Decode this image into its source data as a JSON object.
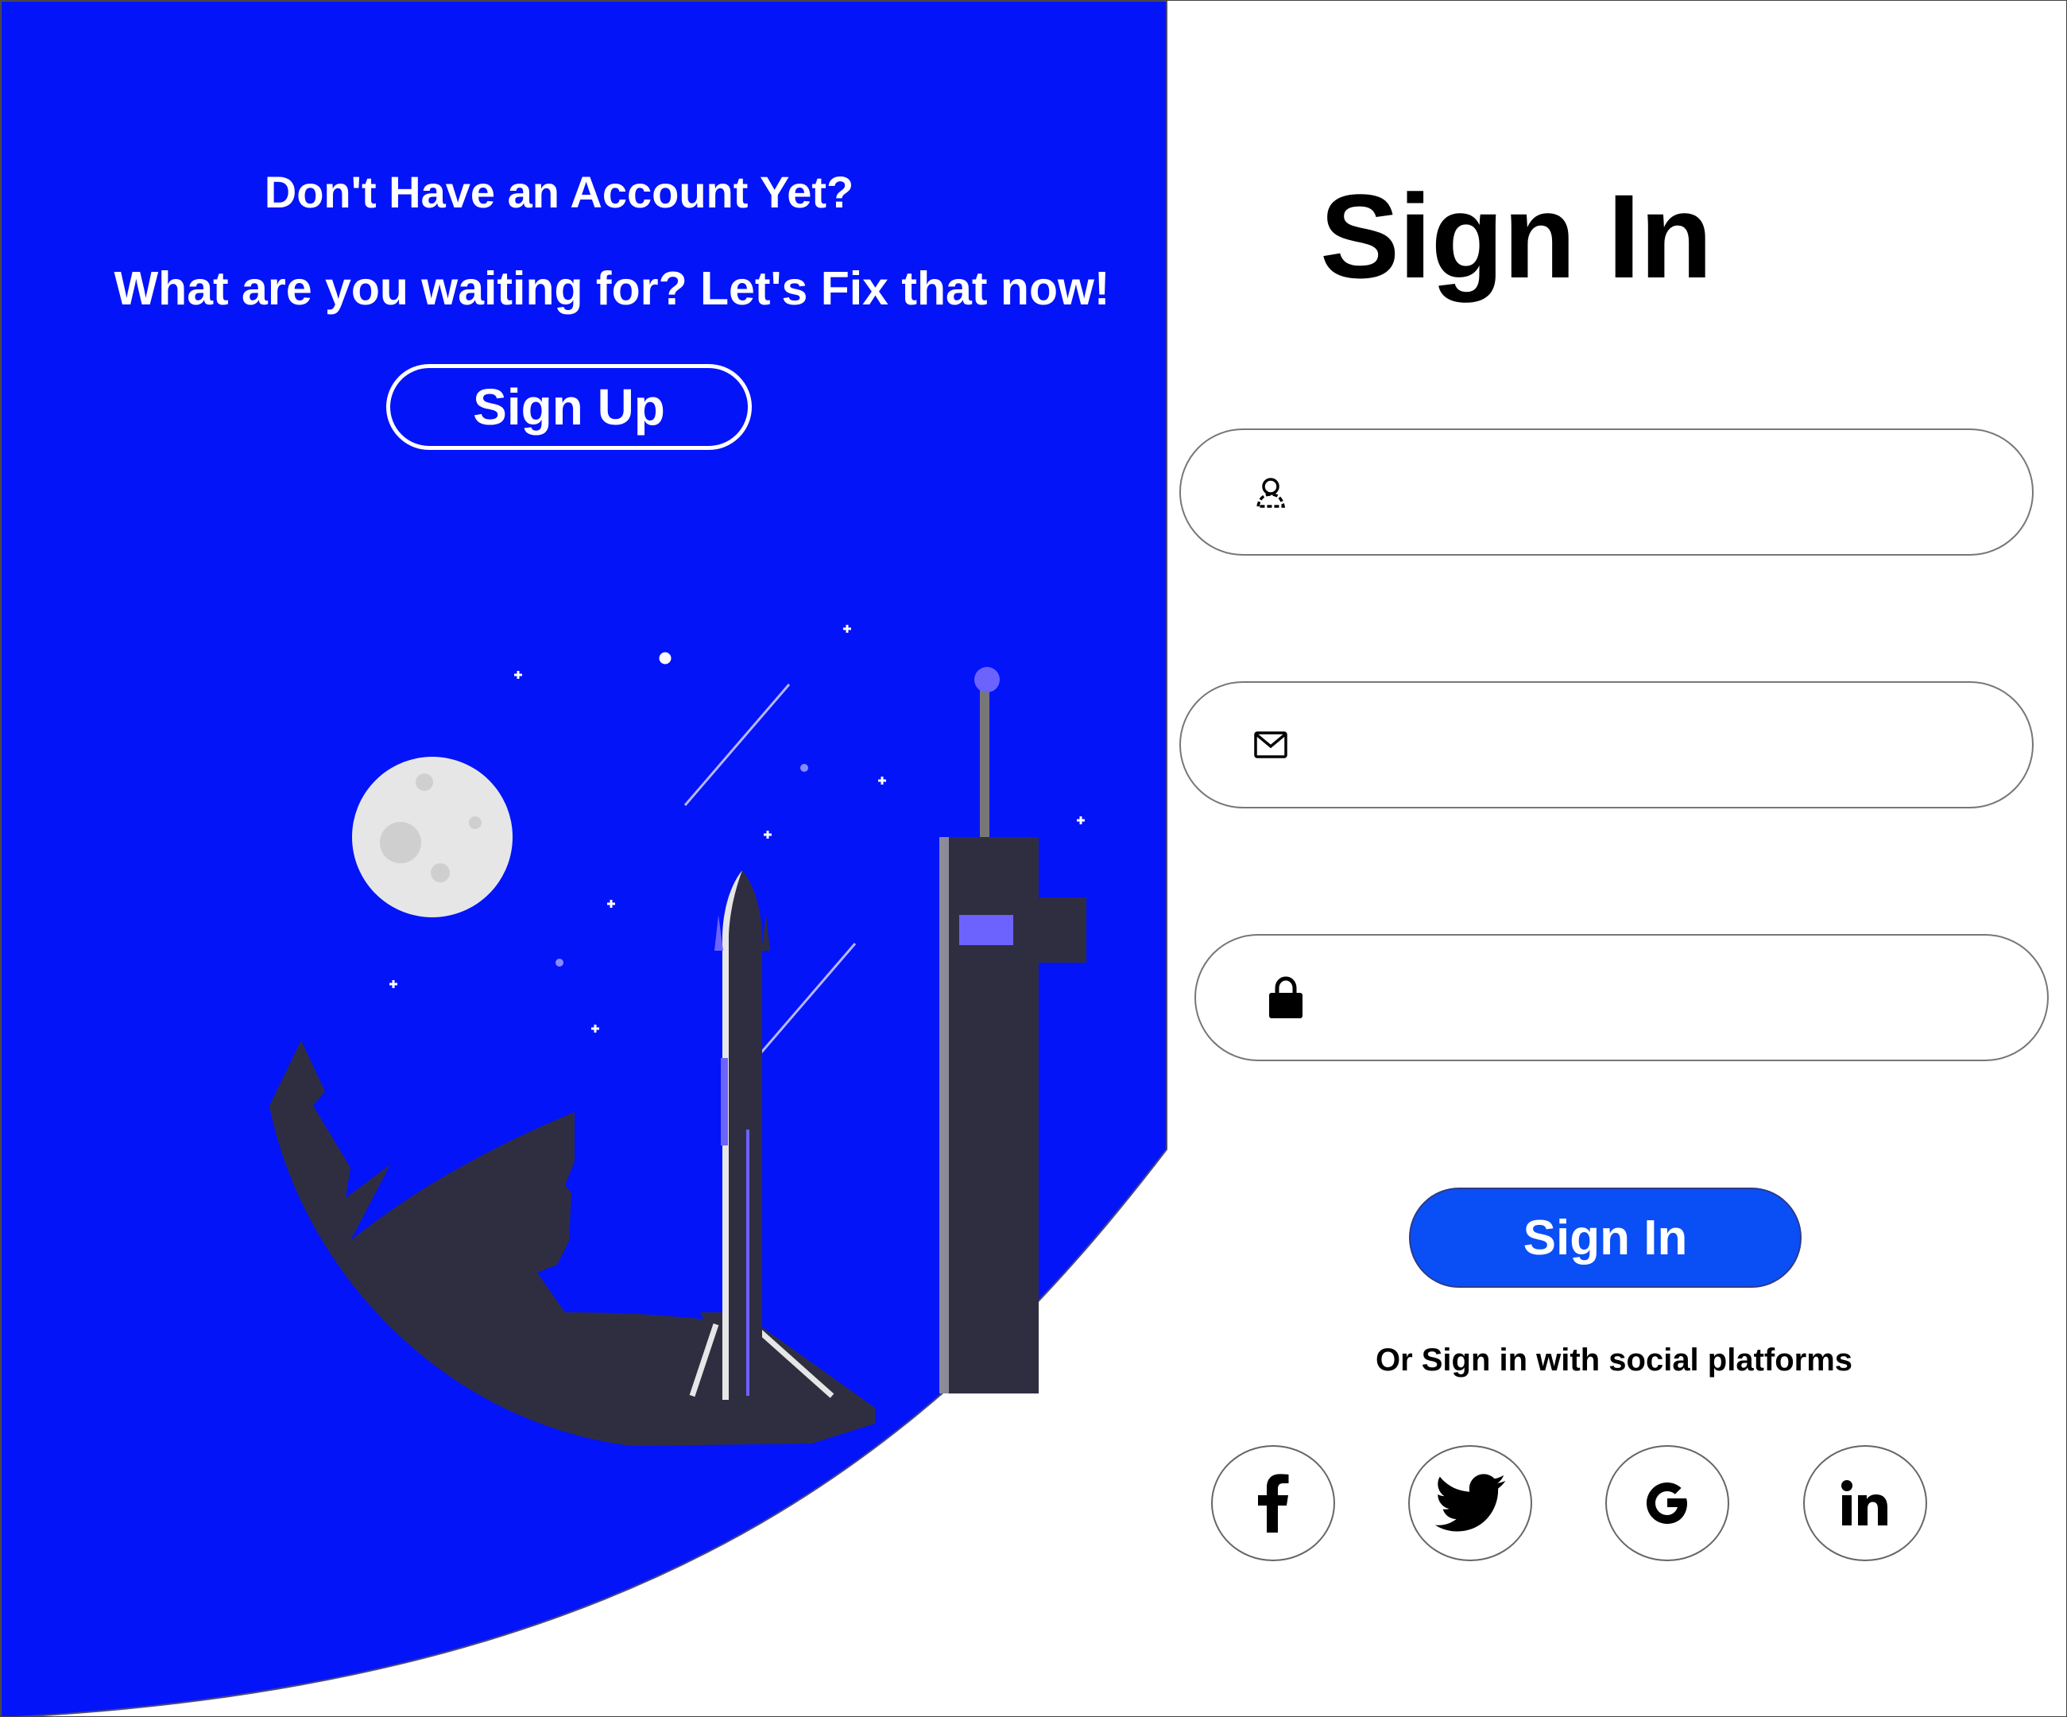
{
  "colors": {
    "panel_blue": "#0414f8",
    "button_blue": "#0a4ff5",
    "dark_silhouette": "#2f2e41",
    "accent_purple": "#6c63ff",
    "moon": "#e6e6e6"
  },
  "promo": {
    "title": "Don't Have an Account Yet?",
    "subtitle": "What are you waiting for? Let's Fix that now!",
    "signup_label": "Sign Up"
  },
  "form": {
    "title": "Sign In",
    "fields": [
      {
        "icon": "user-icon",
        "value": "",
        "placeholder": ""
      },
      {
        "icon": "mail-icon",
        "value": "",
        "placeholder": ""
      },
      {
        "icon": "lock-icon",
        "value": "",
        "placeholder": ""
      }
    ],
    "submit_label": "Sign In",
    "social_label": "Or Sign in with social platforms",
    "social": [
      {
        "icon": "facebook-icon"
      },
      {
        "icon": "twitter-icon"
      },
      {
        "icon": "google-icon"
      },
      {
        "icon": "linkedin-icon"
      }
    ]
  }
}
